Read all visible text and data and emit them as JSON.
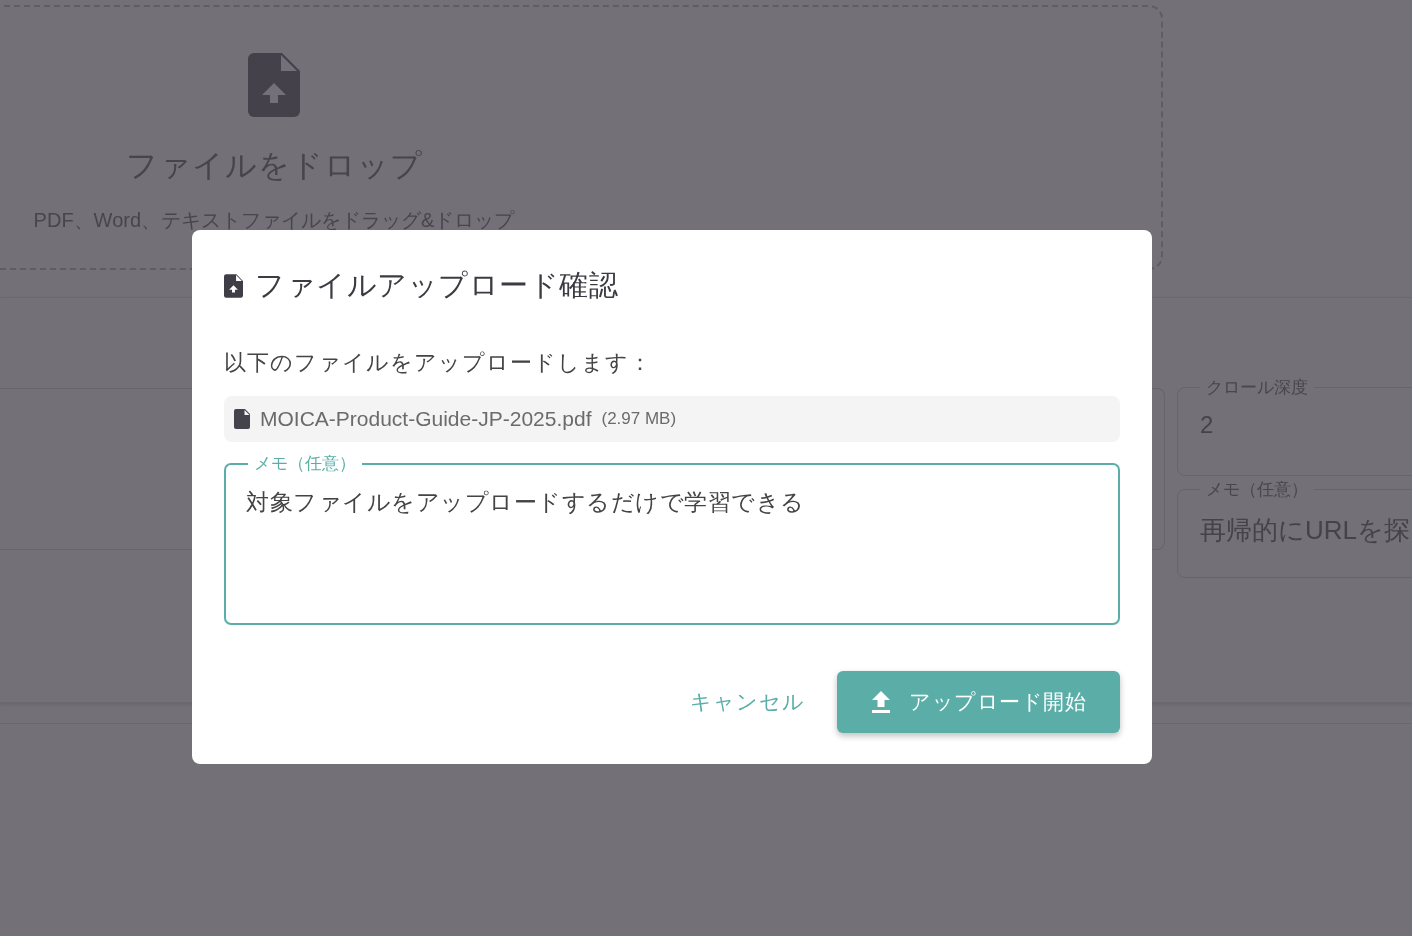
{
  "background": {
    "dropzone": {
      "title": "ファイルをドロップ",
      "subtitle": "PDF、Word、テキストファイルをドラッグ&ドロップ"
    },
    "crawl_depth": {
      "label": "クロール深度",
      "value": "2"
    },
    "memo": {
      "label": "メモ（任意）",
      "value": "再帰的にURLを探"
    }
  },
  "dialog": {
    "title": "ファイルアップロード確認",
    "message": "以下のファイルをアップロードします：",
    "file": {
      "name": "MOICA-Product-Guide-JP-2025.pdf",
      "size": "(2.97 MB)"
    },
    "memo": {
      "label": "メモ（任意）",
      "value": "対象ファイルをアップロードするだけで学習できる",
      "focused": true
    },
    "buttons": [
      {
        "label": "キャンセル",
        "kind": "text"
      },
      {
        "label": "アップロード開始",
        "kind": "primary"
      }
    ]
  }
}
